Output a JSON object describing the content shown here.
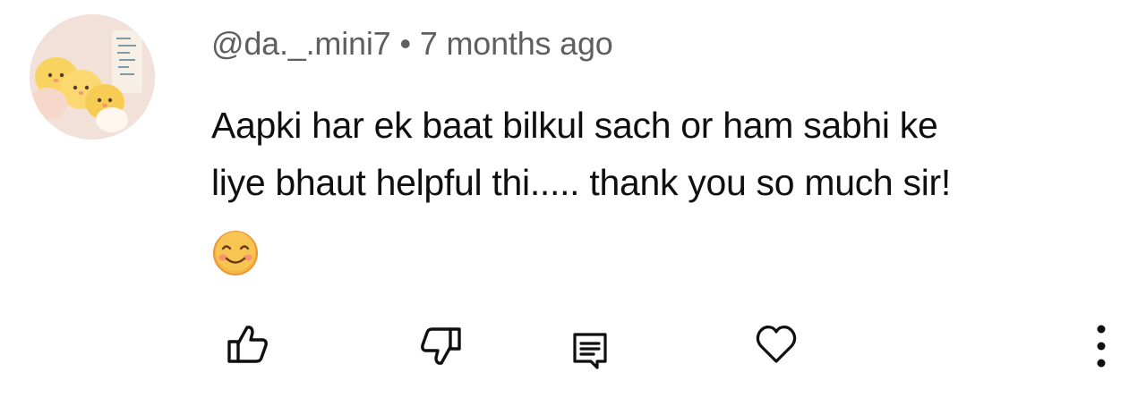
{
  "comment": {
    "author": "@da._.mini7",
    "separator": "•",
    "timestamp": "7 months ago",
    "text_lines": [
      "Aapki har ek baat bilkul sach or ham sabhi ke",
      "liye bhaut helpful thi..... thank you so much sir!"
    ],
    "emoji": "smiling-face-emoji"
  },
  "actions": {
    "like_icon": "thumbs-up-icon",
    "dislike_icon": "thumbs-down-icon",
    "reply_icon": "reply-comment-icon",
    "heart_icon": "heart-icon",
    "more_icon": "more-vertical-icon"
  },
  "colors": {
    "text_primary": "#0f0f0f",
    "text_secondary": "#5f5f5f",
    "icon": "#0f0f0f",
    "emoji_face": "#f5b740"
  }
}
